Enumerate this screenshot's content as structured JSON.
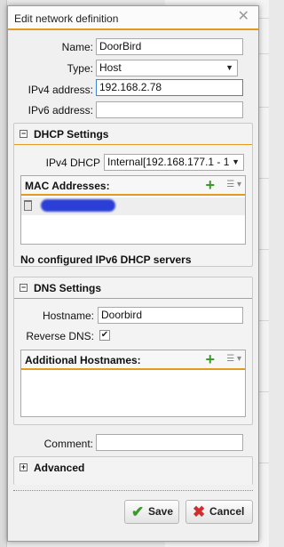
{
  "dialog": {
    "title": "Edit network definition",
    "close_icon": "close-icon"
  },
  "form": {
    "name_label": "Name:",
    "name_value": "DoorBird",
    "type_label": "Type:",
    "type_value": "Host",
    "ipv4_label": "IPv4 address:",
    "ipv4_value": "192.168.2.78",
    "ipv6_label": "IPv6 address:",
    "ipv6_value": ""
  },
  "dhcp": {
    "title": "DHCP Settings",
    "ipv4_dhcp_label": "IPv4 DHCP",
    "ipv4_dhcp_value": "Internal[192.168.177.1 - 1",
    "mac_title": "MAC Addresses:",
    "ipv6_note": "No configured IPv6 DHCP servers"
  },
  "dns": {
    "title": "DNS Settings",
    "hostname_label": "Hostname:",
    "hostname_value": "Doorbird",
    "reverse_label": "Reverse DNS:",
    "reverse_checked": true,
    "additional_title": "Additional Hostnames:"
  },
  "comment": {
    "label": "Comment:",
    "value": ""
  },
  "advanced": {
    "title": "Advanced"
  },
  "buttons": {
    "save": "Save",
    "cancel": "Cancel"
  },
  "colors": {
    "accent": "#e39a1e",
    "add_green": "#3a9a2a",
    "cancel_red": "#d42b2b"
  }
}
